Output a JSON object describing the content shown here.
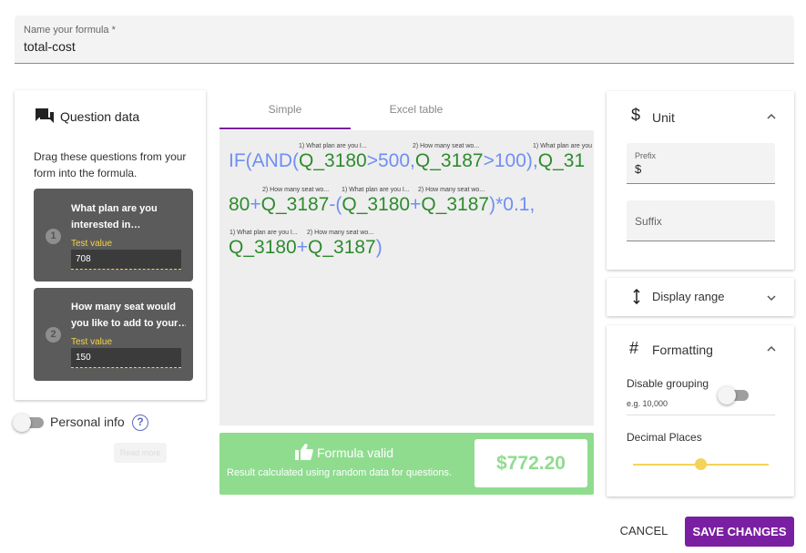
{
  "name_field": {
    "label": "Name your formula *",
    "value": "total-cost"
  },
  "question_panel": {
    "title": "Question data",
    "instructions": "Drag these questions from your form into the formula.",
    "questions": [
      {
        "number": "1",
        "text_line1": "What plan are you",
        "text_line2": "interested in…",
        "test_label": "Test value",
        "test_value": "708"
      },
      {
        "number": "2",
        "text_line1": "How many seat would",
        "text_line2": "you like to add to your…",
        "test_label": "Test value",
        "test_value": "150"
      }
    ]
  },
  "personal_info": {
    "label": "Personal info",
    "help": "?",
    "read_more": "Read more"
  },
  "tabs": [
    {
      "label": "Simple"
    },
    {
      "label": "Excel table"
    }
  ],
  "formula": {
    "refs": {
      "r1": "1) What plan are you I...",
      "r2": "2) How many seat wo...",
      "r3": "1) What plan are you",
      "r4": "2) How many seat wo...",
      "r5": "1) What plan are you I...",
      "r6": "2) How many seat wo...",
      "r7": "1) What plan are you I...",
      "r8": "2) How many seat wo..."
    },
    "line1": {
      "a": "IF(AND(",
      "b": "Q_3180",
      "c": ">500,",
      "d": "Q_3187",
      "e": ">100),",
      "f": "Q_31"
    },
    "line2": {
      "a": "80",
      "b": "+",
      "c": "Q_3187",
      "d": "-(",
      "e": "Q_3180",
      "f": "+",
      "g": "Q_3187",
      "h": ")*0.1,"
    },
    "line3": {
      "a": "Q_3180",
      "b": "+",
      "c": "Q_3187",
      "d": ")"
    }
  },
  "validation": {
    "title": "Formula valid",
    "subtitle": "Result calculated using random data for questions.",
    "result": "$772.20"
  },
  "unit_panel": {
    "title": "Unit",
    "prefix_label": "Prefix",
    "prefix_value": "$",
    "suffix_placeholder": "Suffix"
  },
  "display_panel": {
    "title": "Display range"
  },
  "format_panel": {
    "title": "Formatting",
    "grouping_label": "Disable grouping",
    "grouping_example": "e.g. 10,000",
    "decimal_label": "Decimal Places",
    "decimal_value": 0.5
  },
  "footer": {
    "cancel": "CANCEL",
    "save": "SAVE CHANGES"
  },
  "colors": {
    "accent": "#7b1fa2",
    "valid": "#8fdc8f",
    "formula_func": "#6f8ff2",
    "formula_var": "#2e8b2e",
    "test_value": "#f5d442"
  }
}
